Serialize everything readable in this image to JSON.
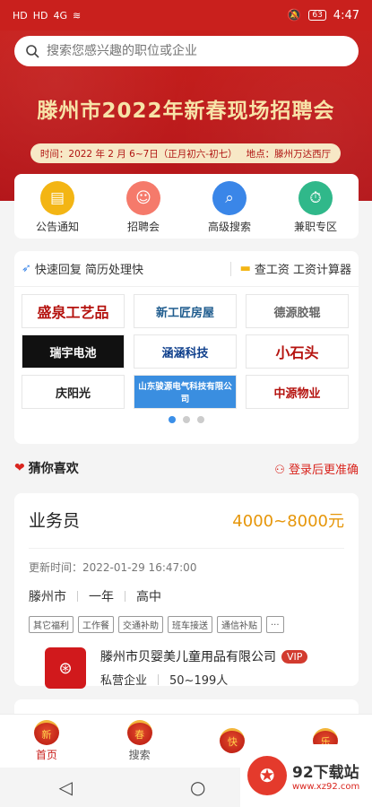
{
  "status": {
    "carrier1": "HD",
    "carrier2": "HD",
    "signal": "4G",
    "battery": "63",
    "time": "4:47"
  },
  "search": {
    "placeholder": "搜索您感兴趣的职位或企业"
  },
  "banner": {
    "title": "滕州市2022年新春现场招聘会",
    "time": "时间：2022 年 2 月 6~7日（正月初六-初七）",
    "place": "地点：滕州万达西厅"
  },
  "quick": [
    {
      "label": "公告通知",
      "icon": "notice-icon",
      "color": "#f3b514"
    },
    {
      "label": "招聘会",
      "icon": "job-fair-icon",
      "color": "#f57a6b"
    },
    {
      "label": "高级搜索",
      "icon": "advanced-search-icon",
      "color": "#3a86e8"
    },
    {
      "label": "兼职专区",
      "icon": "part-time-icon",
      "color": "#30b88a"
    }
  ],
  "tips": {
    "left": "快速回复 简历处理快",
    "right": "查工资 工资计算器"
  },
  "logos": [
    "盛泉工艺品",
    "新工匠房屋",
    "德源胶辊",
    "瑞宇电池",
    "涵涵科技",
    "小石头",
    "庆阳光",
    "山东骏源电气科技有限公司",
    "中源物业"
  ],
  "guess": {
    "title": "猜你喜欢",
    "login": "登录后更准确"
  },
  "job": {
    "title": "业务员",
    "salary": "4000~8000元",
    "updated": "更新时间：2022-01-29 16:47:00",
    "city": "滕州市",
    "experience": "一年",
    "education": "高中",
    "tags": [
      "其它福利",
      "工作餐",
      "交通补助",
      "班车接送",
      "通信补贴",
      "..."
    ],
    "company": "滕州市贝婴美儿童用品有限公司",
    "vip": "VIP",
    "company_type": "私营企业",
    "company_size": "50~199人"
  },
  "tabs": [
    {
      "label": "首页",
      "glyph": "新"
    },
    {
      "label": "搜索",
      "glyph": "春"
    },
    {
      "label": "",
      "glyph": "快"
    },
    {
      "label": "",
      "glyph": "乐"
    }
  ],
  "watermark": {
    "name": "92下载站",
    "url": "www.xz92.com"
  },
  "colors": {
    "brand_red": "#c9201d",
    "salary": "#e6960a",
    "accent": "#d9251e"
  }
}
